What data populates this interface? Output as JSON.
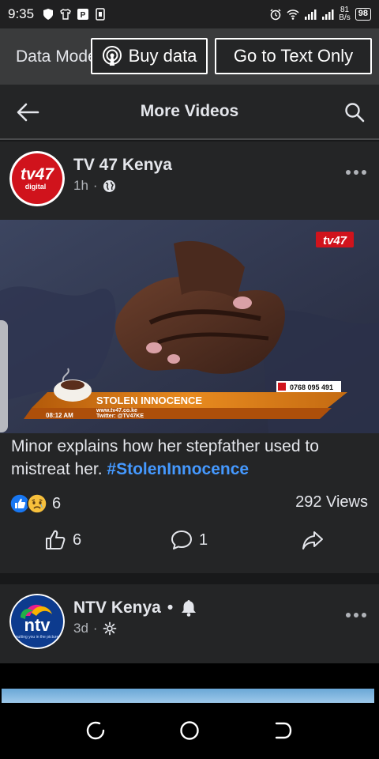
{
  "status": {
    "time": "9:35",
    "net_value": "81",
    "net_unit": "B/s",
    "battery": "98"
  },
  "databar": {
    "mode_label": "Data Mode",
    "buy_label": "Buy data",
    "text_only_label": "Go to Text Only"
  },
  "header": {
    "title": "More Videos"
  },
  "posts": [
    {
      "name": "TV 47 Kenya",
      "time": "1h",
      "privacy_icon": "globe-icon",
      "video": {
        "logo": "tv47",
        "phone": "0768 095 491",
        "lower_third_title": "STOLEN INNOCENCE",
        "website": "www.tv47.co.ke",
        "twitter": "Twitter: @TV47KE",
        "clock": "08:12 AM"
      },
      "caption": "Minor explains how her stepfather used to mistreat her.",
      "hashtag": "#StolenInnocence",
      "reaction_count": "6",
      "views": "292 Views",
      "like_count": "6",
      "comment_count": "1"
    },
    {
      "name": "NTV Kenya",
      "separator": "•",
      "time": "3d",
      "privacy_icon": "gear-icon",
      "avatar_logo": "ntv",
      "avatar_tagline": "putting you in the picture"
    }
  ],
  "colors": {
    "accent": "#4599ff",
    "card": "#242526",
    "background": "#18191a",
    "tv47_red": "#d0131c"
  }
}
